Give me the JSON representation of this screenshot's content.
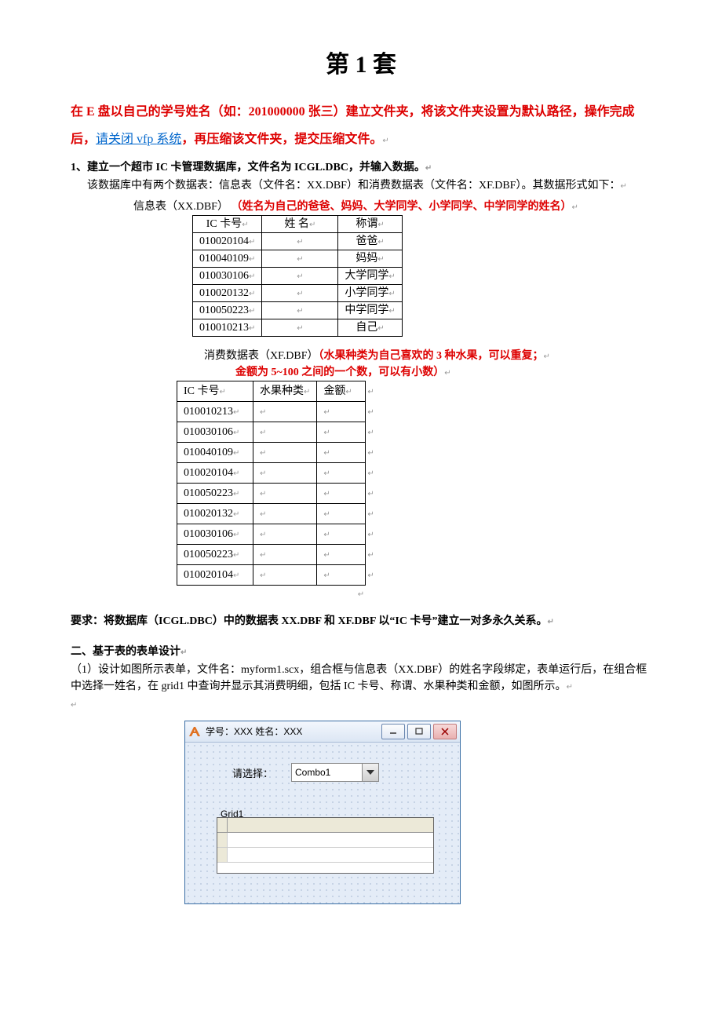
{
  "title": "第 1 套",
  "intro": {
    "seg1": "在 E 盘以自己的学号姓名（如：201000000 张三）建立文件夹，将该文件夹设置为默认路径，操作完成后，",
    "seg_link": "请关闭",
    "seg_vfp": " vfp ",
    "seg_link2": "系统",
    "seg2": "，再压缩该文件夹，提交压缩文件。"
  },
  "q1": {
    "heading": "1、建立一个超市 IC 卡管理数据库，文件名为 ICGL.DBC，并输入数据。",
    "desc": "该数据库中有两个数据表：信息表（文件名：XX.DBF）和消费数据表（文件名：XF.DBF）。其数据形式如下：",
    "info_caption_a": "信息表（XX.DBF）",
    "info_caption_b": "（姓名为自己的爸爸、妈妈、大学同学、小学同学、中学同学的姓名）",
    "info_headers": [
      "IC 卡号",
      "姓 名",
      "称谓"
    ],
    "info_rows": [
      {
        "id": "010020104",
        "name": "",
        "rel": "爸爸"
      },
      {
        "id": "010040109",
        "name": "",
        "rel": "妈妈"
      },
      {
        "id": "010030106",
        "name": "",
        "rel": "大学同学"
      },
      {
        "id": "010020132",
        "name": "",
        "rel": "小学同学"
      },
      {
        "id": "010050223",
        "name": "",
        "rel": "中学同学"
      },
      {
        "id": "010010213",
        "name": "",
        "rel": "自己"
      }
    ],
    "xf_caption_a": "消费数据表（XF.DBF）",
    "xf_caption_b": "（水果种类为自己喜欢的 3 种水果，可以重复；",
    "xf_caption_c": "金额为 5~100 之间的一个数，可以有小数）",
    "xf_headers": [
      "IC 卡号",
      "水果种类",
      "金额"
    ],
    "xf_rows": [
      {
        "id": "010010213"
      },
      {
        "id": "010030106"
      },
      {
        "id": "010040109"
      },
      {
        "id": "010020104"
      },
      {
        "id": "010050223"
      },
      {
        "id": "010020132"
      },
      {
        "id": "010030106"
      },
      {
        "id": "010050223"
      },
      {
        "id": "010020104"
      }
    ],
    "requirement": "要求：将数据库（ICGL.DBC）中的数据表 XX.DBF 和 XF.DBF 以“IC 卡号”建立一对多永久关系。"
  },
  "q2": {
    "heading": "二、基于表的表单设计",
    "desc": "（1）设计如图所示表单，文件名：myform1.scx，组合框与信息表（XX.DBF）的姓名字段绑定，表单运行后，在组合框中选择一姓名，在 grid1 中查询并显示其消费明细，包括 IC 卡号、称谓、水果种类和金额，如图所示。"
  },
  "form": {
    "title": "学号：XXX 姓名：XXX",
    "label": "请选择：",
    "combo": "Combo1",
    "grid": "Grid1"
  },
  "retmark": "↵"
}
